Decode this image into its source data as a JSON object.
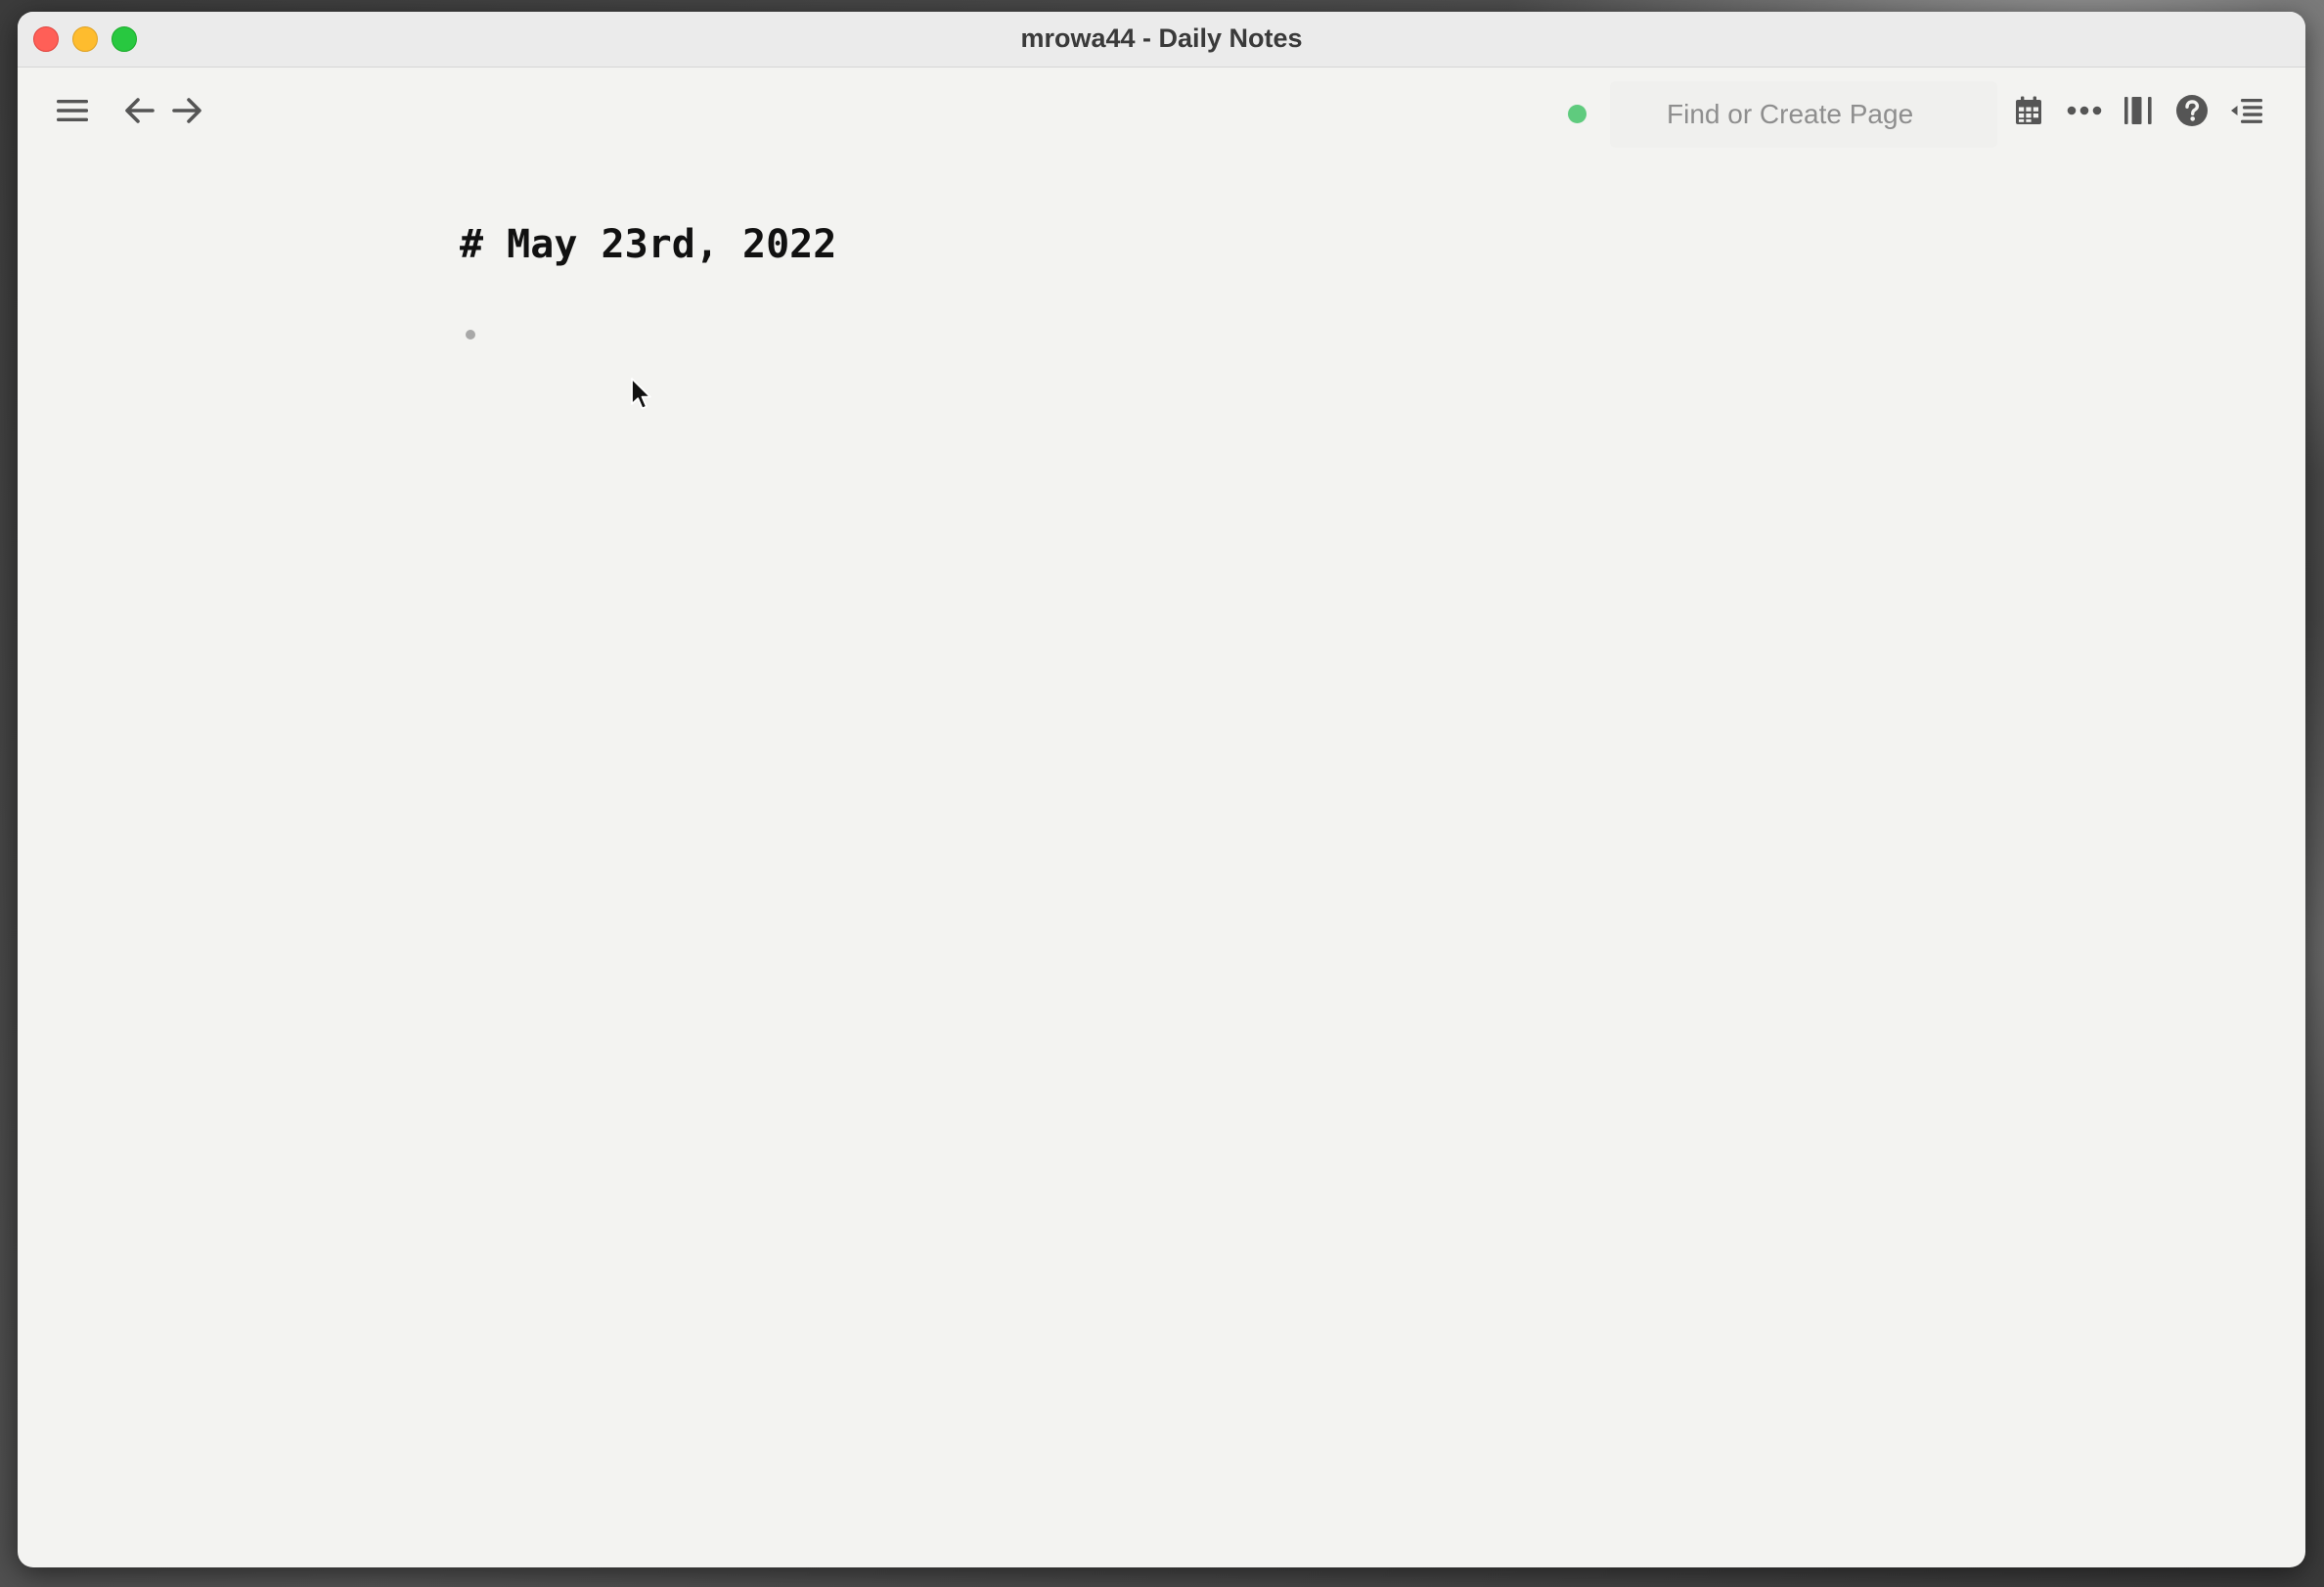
{
  "window": {
    "title": "mrowa44 - Daily Notes"
  },
  "toolbar": {
    "menu_icon": "hamburger-menu-icon",
    "back_icon": "arrow-left-icon",
    "forward_icon": "arrow-right-icon",
    "sync_status_color": "#5fcb7e",
    "search": {
      "placeholder": "Find or Create Page",
      "value": ""
    },
    "right_icons": [
      "calendar-icon",
      "more-dots-icon",
      "sidebar-layout-icon",
      "help-icon",
      "outline-indent-icon"
    ]
  },
  "page": {
    "title": "# May 23rd, 2022"
  },
  "colors": {
    "close": "#ff5f57",
    "minimize": "#febc2e",
    "maximize": "#28c840",
    "sync": "#5fcb7e"
  }
}
